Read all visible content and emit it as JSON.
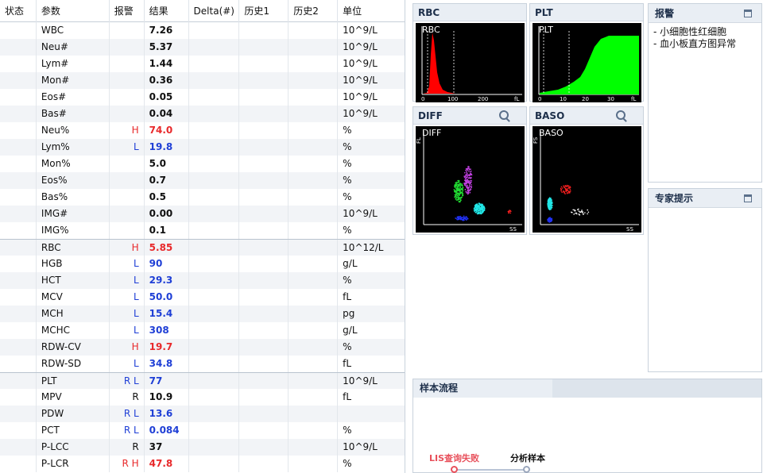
{
  "table": {
    "headers": [
      "状态",
      "参数",
      "报警",
      "结果",
      "Delta(#)",
      "历史1",
      "历史2",
      "单位"
    ],
    "rows": [
      {
        "param": "WBC",
        "flag": "",
        "flag_type": "",
        "result": "7.26",
        "level": "",
        "unit": "10^9/L"
      },
      {
        "param": "Neu#",
        "flag": "",
        "flag_type": "",
        "result": "5.37",
        "level": "",
        "unit": "10^9/L"
      },
      {
        "param": "Lym#",
        "flag": "",
        "flag_type": "",
        "result": "1.44",
        "level": "",
        "unit": "10^9/L"
      },
      {
        "param": "Mon#",
        "flag": "",
        "flag_type": "",
        "result": "0.36",
        "level": "",
        "unit": "10^9/L"
      },
      {
        "param": "Eos#",
        "flag": "",
        "flag_type": "",
        "result": "0.05",
        "level": "",
        "unit": "10^9/L"
      },
      {
        "param": "Bas#",
        "flag": "",
        "flag_type": "",
        "result": "0.04",
        "level": "",
        "unit": "10^9/L"
      },
      {
        "param": "Neu%",
        "flag": "H",
        "flag_type": "hi",
        "result": "74.0",
        "level": "hi",
        "unit": "%"
      },
      {
        "param": "Lym%",
        "flag": "L",
        "flag_type": "lo",
        "result": "19.8",
        "level": "lo",
        "unit": "%"
      },
      {
        "param": "Mon%",
        "flag": "",
        "flag_type": "",
        "result": "5.0",
        "level": "",
        "unit": "%"
      },
      {
        "param": "Eos%",
        "flag": "",
        "flag_type": "",
        "result": "0.7",
        "level": "",
        "unit": "%"
      },
      {
        "param": "Bas%",
        "flag": "",
        "flag_type": "",
        "result": "0.5",
        "level": "",
        "unit": "%"
      },
      {
        "param": "IMG#",
        "flag": "",
        "flag_type": "",
        "result": "0.00",
        "level": "",
        "unit": "10^9/L"
      },
      {
        "param": "IMG%",
        "flag": "",
        "flag_type": "",
        "result": "0.1",
        "level": "",
        "unit": "%"
      },
      {
        "param": "RBC",
        "flag": "H",
        "flag_type": "hi",
        "result": "5.85",
        "level": "hi",
        "unit": "10^12/L",
        "sep": true
      },
      {
        "param": "HGB",
        "flag": "L",
        "flag_type": "lo",
        "result": "90",
        "level": "lo",
        "unit": "g/L"
      },
      {
        "param": "HCT",
        "flag": "L",
        "flag_type": "lo",
        "result": "29.3",
        "level": "lo",
        "unit": "%"
      },
      {
        "param": "MCV",
        "flag": "L",
        "flag_type": "lo",
        "result": "50.0",
        "level": "lo",
        "unit": "fL"
      },
      {
        "param": "MCH",
        "flag": "L",
        "flag_type": "lo",
        "result": "15.4",
        "level": "lo",
        "unit": "pg"
      },
      {
        "param": "MCHC",
        "flag": "L",
        "flag_type": "lo",
        "result": "308",
        "level": "lo",
        "unit": "g/L"
      },
      {
        "param": "RDW-CV",
        "flag": "H",
        "flag_type": "hi",
        "result": "19.7",
        "level": "hi",
        "unit": "%"
      },
      {
        "param": "RDW-SD",
        "flag": "L",
        "flag_type": "lo",
        "result": "34.8",
        "level": "lo",
        "unit": "fL"
      },
      {
        "param": "PLT",
        "flag": "R L",
        "flag_type": "lo",
        "result": "77",
        "level": "lo",
        "unit": "10^9/L",
        "sep": true
      },
      {
        "param": "MPV",
        "flag": "R",
        "flag_type": "plain",
        "result": "10.9",
        "level": "",
        "unit": "fL"
      },
      {
        "param": "PDW",
        "flag": "R L",
        "flag_type": "lo",
        "result": "13.6",
        "level": "lo",
        "unit": ""
      },
      {
        "param": "PCT",
        "flag": "R L",
        "flag_type": "lo",
        "result": "0.084",
        "level": "lo",
        "unit": "%"
      },
      {
        "param": "P-LCC",
        "flag": "R",
        "flag_type": "plain",
        "result": "37",
        "level": "",
        "unit": "10^9/L"
      },
      {
        "param": "P-LCR",
        "flag": "R H",
        "flag_type": "hi",
        "result": "47.8",
        "level": "hi",
        "unit": "%"
      }
    ]
  },
  "panels": {
    "rbc": {
      "title": "RBC",
      "label": "RBC",
      "ticks": [
        "0",
        "100",
        "200",
        "fL"
      ]
    },
    "plt": {
      "title": "PLT",
      "label": "PLT",
      "ticks": [
        "0",
        "10",
        "20",
        "30",
        "fL"
      ]
    },
    "diff": {
      "title": "DIFF",
      "label": "DIFF",
      "y_axis": "FL",
      "x_axis": "SS"
    },
    "baso": {
      "title": "BASO",
      "label": "BASO",
      "y_axis": "FS",
      "x_axis": "SS"
    }
  },
  "alarm": {
    "title": "报警",
    "items": [
      "- 小细胞性红细胞",
      "- 血小板直方图异常"
    ]
  },
  "expert": {
    "title": "专家提示"
  },
  "flow": {
    "title": "样本流程",
    "steps": [
      {
        "label": "LIS查询失败",
        "color": "#e8505b"
      },
      {
        "label": "分析样本",
        "color": "#111111"
      }
    ]
  }
}
